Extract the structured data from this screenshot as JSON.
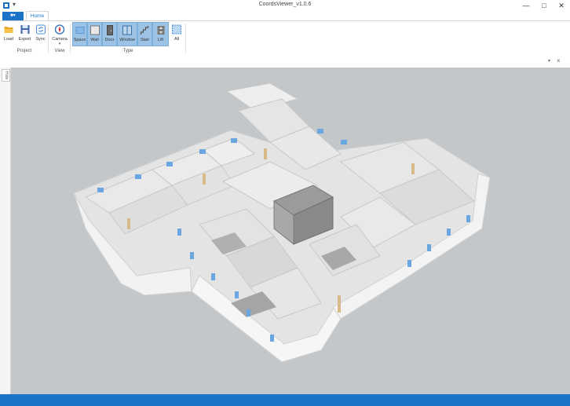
{
  "window": {
    "title": "CoordsViewer_v1.0.6",
    "minimize_glyph": "—",
    "maximize_glyph": "□",
    "close_glyph": "✕",
    "pin_glyph": "▾"
  },
  "tabs": {
    "file_label": "■▾",
    "home_label": "Home"
  },
  "ribbon": {
    "project": {
      "group_label": "Project",
      "buttons": [
        {
          "label": "Load",
          "icon": "folder-open-icon"
        },
        {
          "label": "Export",
          "icon": "save-export-icon"
        },
        {
          "label": "Sync",
          "icon": "sync-icon"
        }
      ]
    },
    "view": {
      "group_label": "View",
      "buttons": [
        {
          "label": "Camera",
          "icon": "compass-camera-icon"
        }
      ]
    },
    "type": {
      "group_label": "Type",
      "buttons": [
        {
          "label": "Space",
          "icon": "space-icon",
          "selected": true
        },
        {
          "label": "Wall",
          "icon": "wall-icon",
          "selected": true
        },
        {
          "label": "Door",
          "icon": "door-icon",
          "selected": true
        },
        {
          "label": "Window",
          "icon": "window-icon",
          "selected": true
        },
        {
          "label": "Stair",
          "icon": "stair-icon",
          "selected": true
        },
        {
          "label": "Lift",
          "icon": "lift-icon",
          "selected": true
        },
        {
          "label": "All",
          "icon": "select-all-icon",
          "selected": false
        }
      ]
    }
  },
  "document": {
    "pin_glyph": "▾",
    "close_glyph": "×",
    "side_tab_label": "Hide"
  },
  "colors": {
    "accent": "#1a73c9",
    "selected_bg": "#9cc3e5",
    "viewport_bg": "#c3c7c9",
    "wall": "#ececec",
    "floor": "#9a9a9a",
    "window": "#6aa7e0",
    "door": "#d8b98a"
  }
}
